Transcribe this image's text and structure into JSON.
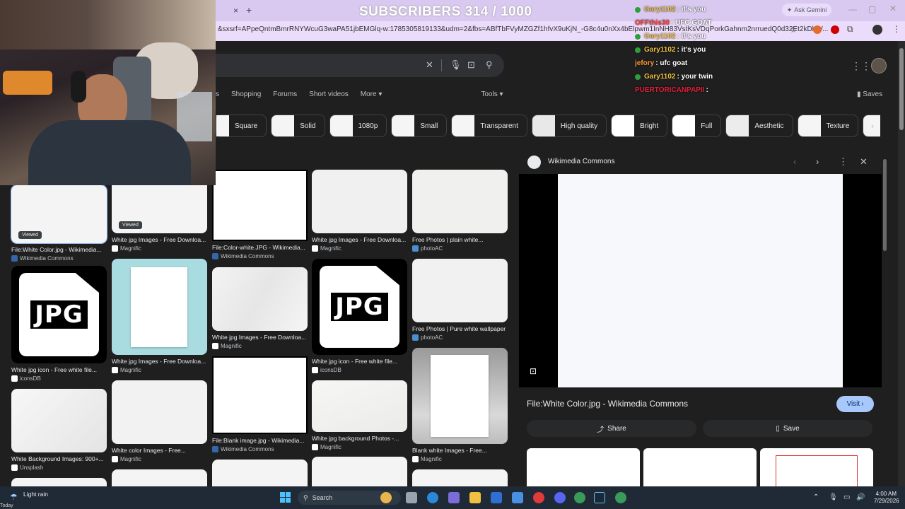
{
  "stream": {
    "subscribers": "SUBSCRIBERS 314 / 1000",
    "chat": [
      {
        "user": "Gary1102",
        "msg": ": it's you",
        "color": "#f0c040",
        "badge": true
      },
      {
        "user": "OFFthis30",
        "msg": ": UFC GOAT",
        "color": "#ff3b3b",
        "badge": false
      },
      {
        "user": "Gary1102",
        "msg": ": it's you",
        "color": "#f0c040",
        "badge": true
      },
      {
        "user": "Gary1102",
        "msg": ": it's you",
        "color": "#f0c040",
        "badge": true
      },
      {
        "user": "jefory",
        "msg": ": ufc goat",
        "color": "#ff9a3c",
        "badge": false
      },
      {
        "user": "Gary1102",
        "msg": ": your twin",
        "color": "#f0c040",
        "badge": true
      },
      {
        "user": "PUERTORICANPAPII",
        "msg": ":",
        "color": "#e0203a",
        "badge": false
      }
    ]
  },
  "browser": {
    "url": "&sxsrf=APpeQntmBmrRNYWcuG3waPA51jbEMGlq-w:1785305819133&udm=2&fbs=ABfTbFVyMZGZf1hfvX9uKjN_-G8c4u0nXx4bElpwm1InNH83VstKsVDqPorkGahnm2nrruedQ0d32Et2kDhW...",
    "ask_gemini": "Ask Gemini"
  },
  "google": {
    "nav_tabs": [
      "s",
      "Shopping",
      "Forums",
      "Short videos",
      "More ▾",
      "Tools ▾"
    ],
    "saves": "Saves",
    "chips": [
      "Square",
      "Solid",
      "1080p",
      "Small",
      "Transparent",
      "High quality",
      "Bright",
      "Full",
      "Aesthetic",
      "Texture",
      "Ba"
    ]
  },
  "results": [
    {
      "title": "File:White Color.jpg - Wikimedia...",
      "source": "Wikimedia Commons",
      "badge": "Viewed"
    },
    {
      "title": "White jpg Images - Free Downloa...",
      "source": "Magnific",
      "badge": "Viewed"
    },
    {
      "title": "File:Color-white.JPG - Wikimedia...",
      "source": "Wikimedia Commons"
    },
    {
      "title": "White jpg Images - Free Downloa...",
      "source": "Magnific"
    },
    {
      "title": "Free Photos | plain white...",
      "source": "photoAC"
    },
    {
      "title": "White jpg icon - Free white file...",
      "source": "iconsDB",
      "jpg_text": "JPG"
    },
    {
      "title": "White jpg Images - Free Downloa...",
      "source": "Magnific"
    },
    {
      "title": "White jpg Images - Free Downloa...",
      "source": "Magnific"
    },
    {
      "title": "White jpg icon - Free white file...",
      "source": "iconsDB",
      "jpg_text": "JPG"
    },
    {
      "title": "Free Photos | Pure white wallpaper",
      "source": "photoAC"
    },
    {
      "title": "White Background Images: 900+...",
      "source": "Unsplash"
    },
    {
      "title": "White color Images - Free...",
      "source": "Magnific"
    },
    {
      "title": "File:Blank image.jpg - Wikimedia...",
      "source": "Wikimedia Commons"
    },
    {
      "title": "White jpg background Photos -...",
      "source": "Magnific"
    },
    {
      "title": "Blank white Images - Free...",
      "source": "Magnific"
    }
  ],
  "panel": {
    "source": "Wikimedia Commons",
    "title": "File:White Color.jpg - Wikimedia Commons",
    "visit": "Visit",
    "share": "Share",
    "save": "Save"
  },
  "taskbar": {
    "weather": "Light rain",
    "weather_sub": "Today",
    "search": "Search",
    "time": "4:00 AM",
    "date": "7/29/2026"
  }
}
